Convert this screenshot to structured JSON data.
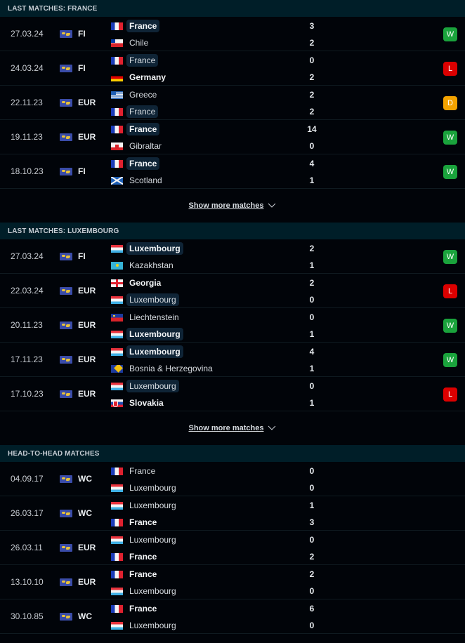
{
  "sections": [
    {
      "title": "LAST MATCHES: FRANCE",
      "show_more": "Show more matches",
      "matches": [
        {
          "date": "27.03.24",
          "competition": "FI",
          "home": {
            "name": "France",
            "flag": "france",
            "bold": true,
            "highlight": true
          },
          "away": {
            "name": "Chile",
            "flag": "chile",
            "bold": false,
            "highlight": false
          },
          "home_score": "3",
          "away_score": "2",
          "result": "W"
        },
        {
          "date": "24.03.24",
          "competition": "FI",
          "home": {
            "name": "France",
            "flag": "france",
            "bold": false,
            "highlight": true
          },
          "away": {
            "name": "Germany",
            "flag": "germany",
            "bold": true,
            "highlight": false
          },
          "home_score": "0",
          "away_score": "2",
          "result": "L"
        },
        {
          "date": "22.11.23",
          "competition": "EUR",
          "home": {
            "name": "Greece",
            "flag": "greece",
            "bold": false,
            "highlight": false
          },
          "away": {
            "name": "France",
            "flag": "france",
            "bold": false,
            "highlight": true
          },
          "home_score": "2",
          "away_score": "2",
          "result": "D"
        },
        {
          "date": "19.11.23",
          "competition": "EUR",
          "home": {
            "name": "France",
            "flag": "france",
            "bold": true,
            "highlight": true
          },
          "away": {
            "name": "Gibraltar",
            "flag": "gibraltar",
            "bold": false,
            "highlight": false
          },
          "home_score": "14",
          "away_score": "0",
          "result": "W"
        },
        {
          "date": "18.10.23",
          "competition": "FI",
          "home": {
            "name": "France",
            "flag": "france",
            "bold": true,
            "highlight": true
          },
          "away": {
            "name": "Scotland",
            "flag": "scotland",
            "bold": false,
            "highlight": false
          },
          "home_score": "4",
          "away_score": "1",
          "result": "W"
        }
      ]
    },
    {
      "title": "LAST MATCHES: LUXEMBOURG",
      "show_more": "Show more matches",
      "matches": [
        {
          "date": "27.03.24",
          "competition": "FI",
          "home": {
            "name": "Luxembourg",
            "flag": "luxembourg",
            "bold": true,
            "highlight": true
          },
          "away": {
            "name": "Kazakhstan",
            "flag": "kazakhstan",
            "bold": false,
            "highlight": false
          },
          "home_score": "2",
          "away_score": "1",
          "result": "W"
        },
        {
          "date": "22.03.24",
          "competition": "EUR",
          "home": {
            "name": "Georgia",
            "flag": "georgia",
            "bold": true,
            "highlight": false
          },
          "away": {
            "name": "Luxembourg",
            "flag": "luxembourg",
            "bold": false,
            "highlight": true
          },
          "home_score": "2",
          "away_score": "0",
          "result": "L"
        },
        {
          "date": "20.11.23",
          "competition": "EUR",
          "home": {
            "name": "Liechtenstein",
            "flag": "liechtenstein",
            "bold": false,
            "highlight": false
          },
          "away": {
            "name": "Luxembourg",
            "flag": "luxembourg",
            "bold": true,
            "highlight": true
          },
          "home_score": "0",
          "away_score": "1",
          "result": "W"
        },
        {
          "date": "17.11.23",
          "competition": "EUR",
          "home": {
            "name": "Luxembourg",
            "flag": "luxembourg",
            "bold": true,
            "highlight": true
          },
          "away": {
            "name": "Bosnia & Herzegovina",
            "flag": "bosnia",
            "bold": false,
            "highlight": false
          },
          "home_score": "4",
          "away_score": "1",
          "result": "W"
        },
        {
          "date": "17.10.23",
          "competition": "EUR",
          "home": {
            "name": "Luxembourg",
            "flag": "luxembourg",
            "bold": false,
            "highlight": true
          },
          "away": {
            "name": "Slovakia",
            "flag": "slovakia",
            "bold": true,
            "highlight": false
          },
          "home_score": "0",
          "away_score": "1",
          "result": "L"
        }
      ]
    },
    {
      "title": "HEAD-TO-HEAD MATCHES",
      "matches": [
        {
          "date": "04.09.17",
          "competition": "WC",
          "home": {
            "name": "France",
            "flag": "france",
            "bold": false,
            "highlight": false
          },
          "away": {
            "name": "Luxembourg",
            "flag": "luxembourg",
            "bold": false,
            "highlight": false
          },
          "home_score": "0",
          "away_score": "0",
          "result": ""
        },
        {
          "date": "26.03.17",
          "competition": "WC",
          "home": {
            "name": "Luxembourg",
            "flag": "luxembourg",
            "bold": false,
            "highlight": false
          },
          "away": {
            "name": "France",
            "flag": "france",
            "bold": true,
            "highlight": false
          },
          "home_score": "1",
          "away_score": "3",
          "result": ""
        },
        {
          "date": "26.03.11",
          "competition": "EUR",
          "home": {
            "name": "Luxembourg",
            "flag": "luxembourg",
            "bold": false,
            "highlight": false
          },
          "away": {
            "name": "France",
            "flag": "france",
            "bold": true,
            "highlight": false
          },
          "home_score": "0",
          "away_score": "2",
          "result": ""
        },
        {
          "date": "13.10.10",
          "competition": "EUR",
          "home": {
            "name": "France",
            "flag": "france",
            "bold": true,
            "highlight": false
          },
          "away": {
            "name": "Luxembourg",
            "flag": "luxembourg",
            "bold": false,
            "highlight": false
          },
          "home_score": "2",
          "away_score": "0",
          "result": ""
        },
        {
          "date": "30.10.85",
          "competition": "WC",
          "home": {
            "name": "France",
            "flag": "france",
            "bold": true,
            "highlight": false
          },
          "away": {
            "name": "Luxembourg",
            "flag": "luxembourg",
            "bold": false,
            "highlight": false
          },
          "home_score": "6",
          "away_score": "0",
          "result": ""
        }
      ]
    }
  ],
  "colors": {
    "win": "#1aa33c",
    "loss": "#dc0000",
    "draw": "#f4a300",
    "header_bg": "#001e28",
    "page_bg": "#010409"
  }
}
